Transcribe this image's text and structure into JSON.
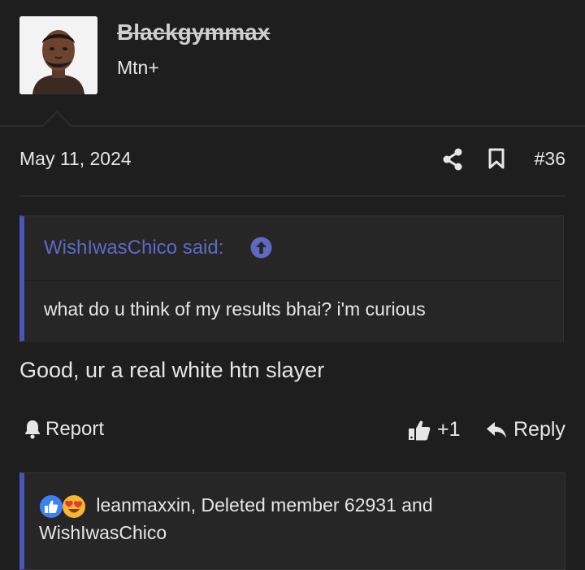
{
  "author": {
    "username": "Blackgymmax",
    "user_title": "Mtn+",
    "avatar_icon": "user-avatar-photo"
  },
  "post": {
    "date": "May 11, 2024",
    "number": "#36",
    "share_icon": "share-icon",
    "bookmark_icon": "bookmark-icon"
  },
  "quote": {
    "author_line": "WishIwasChico said:",
    "jump_icon": "arrow-up-circle-icon",
    "text": "what do u think of my results bhai? i'm curious"
  },
  "reply": {
    "text": "Good, ur a real white htn slayer"
  },
  "actions": {
    "report_label": "Report",
    "like_label": "+1",
    "reply_label": "Reply"
  },
  "reactions": {
    "line": "leanmaxxin, Deleted member 62931 and WishIwasChico",
    "icons": [
      "like-reaction-icon",
      "love-reaction-icon"
    ]
  },
  "colors": {
    "background": "#1e1e1e",
    "accent": "#4a55b8",
    "quote_author": "#5c6bc0"
  }
}
